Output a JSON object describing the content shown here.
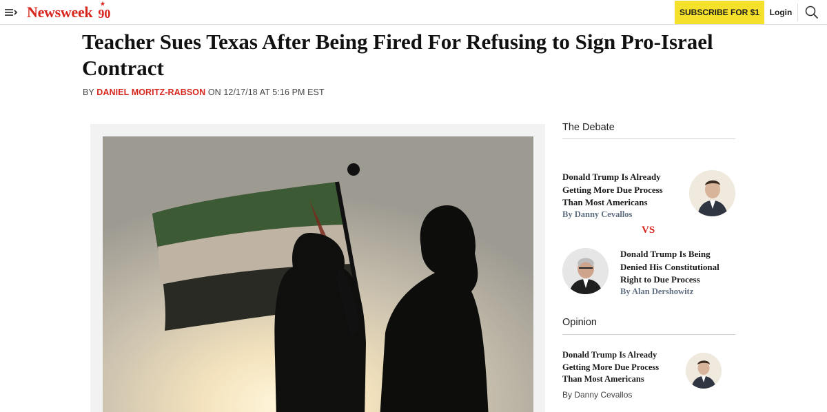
{
  "header": {
    "logo_word": "Newsweek",
    "logo_badge": "90",
    "subscribe_label": "SUBSCRIBE FOR $1",
    "login_label": "Login"
  },
  "article": {
    "headline": "Teacher Sues Texas After Being Fired For Refusing to Sign Pro-Israel Contract",
    "by_prefix": "BY",
    "author": "DANIEL MORITZ-RABSON",
    "date_text": "ON 12/17/18 AT 5:16 PM EST"
  },
  "sidebar": {
    "debate_title": "The Debate",
    "debate": [
      {
        "title": "Donald Trump Is Already Getting More Due Process Than Most Americans",
        "byline": "By Danny Cevallos"
      },
      {
        "title": "Donald Trump Is Being Denied His Constitutional Right to Due Process",
        "byline": "By Alan Dershowitz"
      }
    ],
    "vs_label": "VS",
    "opinion_title": "Opinion",
    "opinion": {
      "title": "Donald Trump Is Already Getting More Due Process Than Most Americans",
      "byline": "By Danny Cevallos"
    }
  },
  "colors": {
    "brand_red": "#d7261e",
    "subscribe_yellow": "#f5e02b",
    "byline_blue_gray": "#5f6e80"
  },
  "icons": {
    "menu": "menu-icon",
    "search": "search-icon"
  }
}
